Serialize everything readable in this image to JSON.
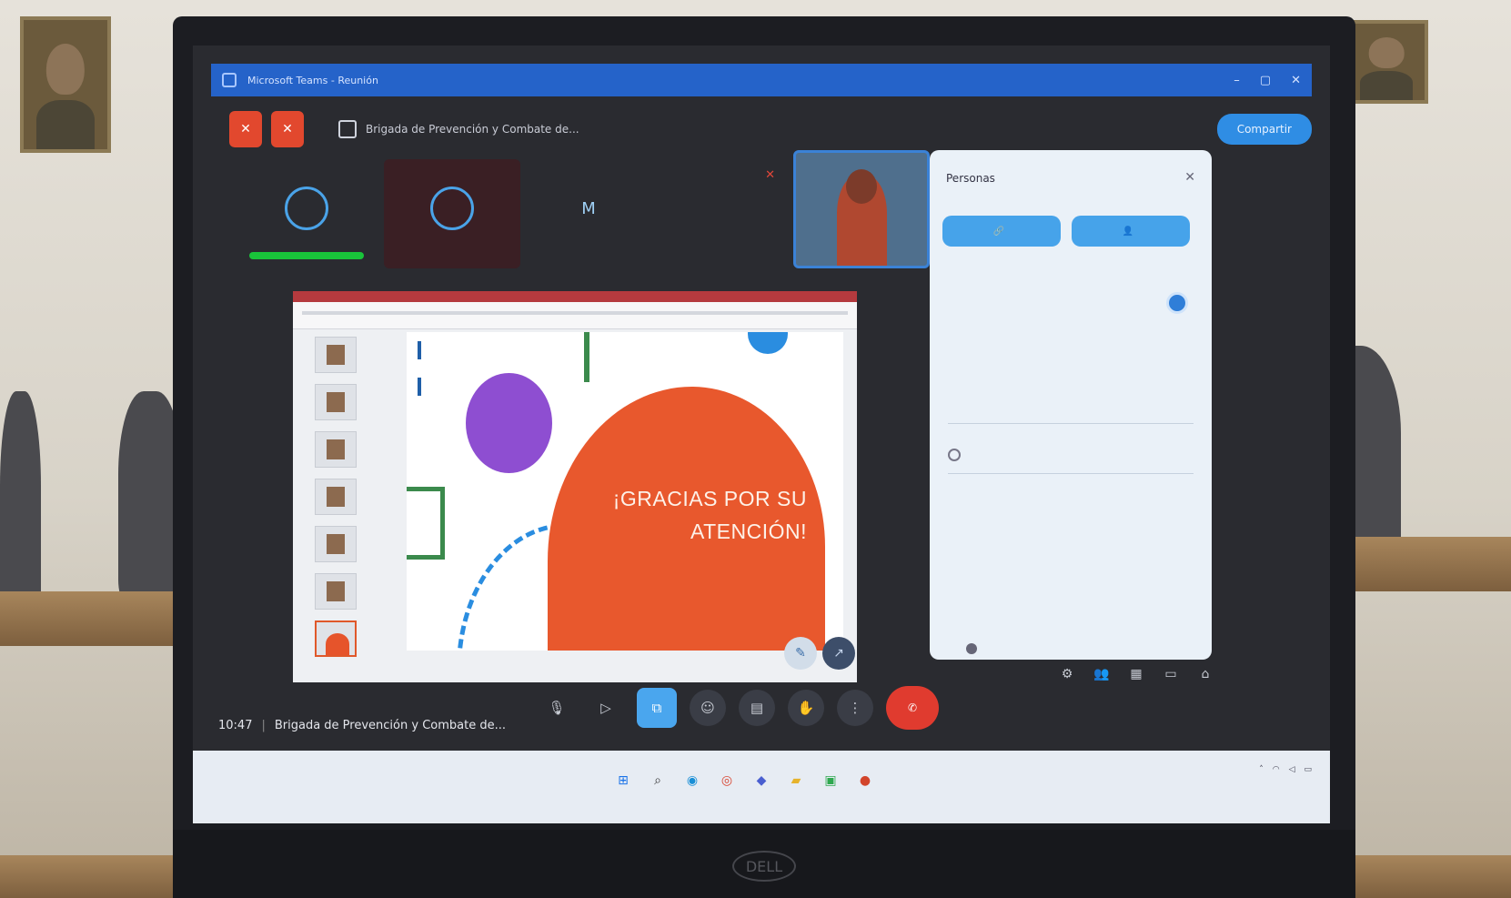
{
  "window": {
    "title_text": "Microsoft Teams - Reunión"
  },
  "meeting": {
    "title": "Brigada de Prevención y Combate de...",
    "time": "10:47",
    "share_button": "Compartir"
  },
  "participants": [
    {
      "initials": "",
      "name": "",
      "speaking": true,
      "muted": false
    },
    {
      "initials": "",
      "name": "",
      "speaking": false,
      "muted": false
    },
    {
      "initials": "M",
      "name": "",
      "speaking": false,
      "muted": false
    },
    {
      "initials": "",
      "name": "",
      "speaking": false,
      "muted": true
    }
  ],
  "slide": {
    "line1": "¡GRACIAS POR SU",
    "line2": "ATENCIÓN!",
    "thumbnail_count": 7
  },
  "panel": {
    "title": "Personas",
    "btn_share": "",
    "btn_invite": "",
    "allow_text": "",
    "search_placeholder": "",
    "section1": "",
    "section2": "",
    "link": ""
  },
  "controls": {
    "end_label": "",
    "items": [
      "mic-icon",
      "camera-icon",
      "share-icon",
      "people-icon",
      "chat-icon",
      "hand-icon",
      "more-icon"
    ]
  },
  "taskbar": {
    "apps": [
      "windows-icon",
      "search-icon",
      "edge-icon",
      "chrome-icon",
      "teams-icon",
      "files-icon",
      "store-icon",
      "powerpoint-icon"
    ]
  },
  "colors": {
    "accent_blue": "#2f8de4",
    "end_call_red": "#e03b2f",
    "slide_orange": "#e8582d",
    "slide_purple": "#8e4ed1",
    "speaking_green": "#19c43a"
  }
}
